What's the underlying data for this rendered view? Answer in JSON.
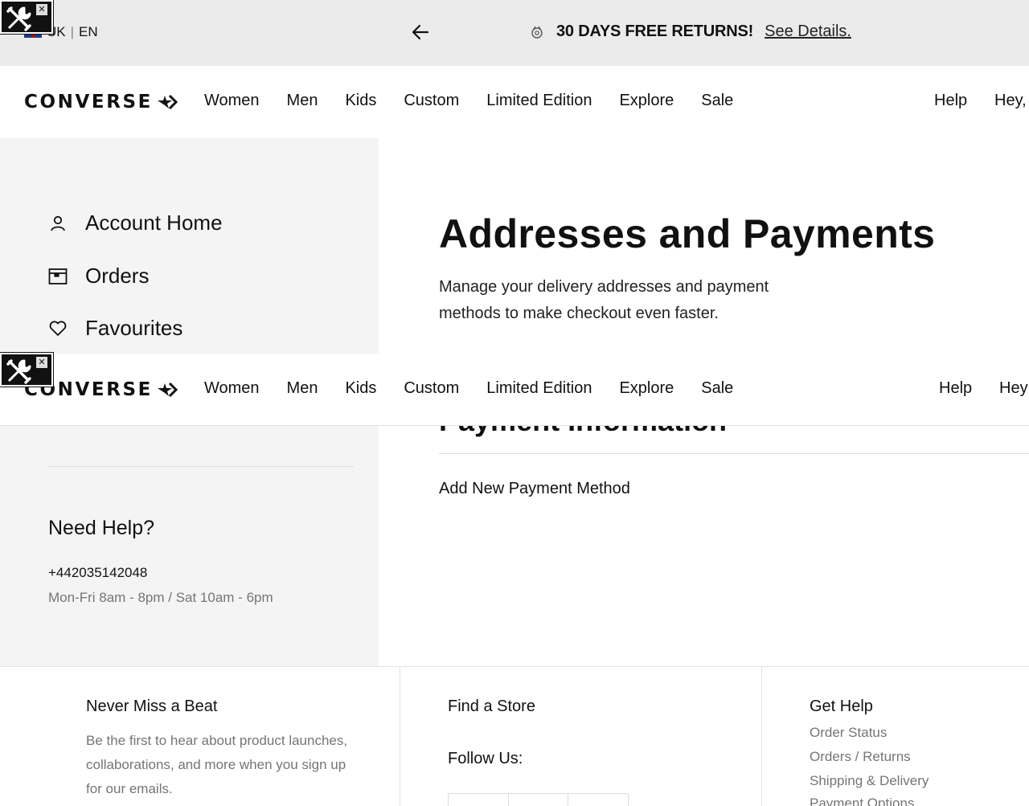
{
  "topbar": {
    "country": "UK",
    "language": "EN",
    "separator": "|",
    "promo_text": "30 DAYS FREE RETURNS!",
    "promo_link": "See Details."
  },
  "brand": {
    "logo_text": "CONVERSE"
  },
  "nav": [
    "Women",
    "Men",
    "Kids",
    "Custom",
    "Limited Edition",
    "Explore",
    "Sale"
  ],
  "header_right": {
    "help": "Help",
    "greeting": "Hey,",
    "greeting_cut": "Hey"
  },
  "sidebar": {
    "items": [
      {
        "label": "Account Home",
        "icon": "user-icon"
      },
      {
        "label": "Orders",
        "icon": "box-icon"
      },
      {
        "label": "Favourites",
        "icon": "heart-icon"
      }
    ],
    "help_title": "Need Help?",
    "help_phone": "+442035142048",
    "help_hours": "Mon-Fri 8am - 8pm / Sat 10am - 6pm"
  },
  "main": {
    "title": "Addresses and Payments",
    "description": "Manage your delivery addresses and payment methods to make checkout even faster.",
    "payment_title": "Payment Information",
    "add_payment": "Add New Payment Method"
  },
  "footer": {
    "col1_title": "Never Miss a Beat",
    "col1_text": "Be the first to hear about product launches, collaborations, and more when you sign up for our emails.",
    "col2_title": "Find a Store",
    "col2_follow": "Follow Us:",
    "col3_title": "Get Help",
    "col3_links": [
      "Order Status",
      "Orders / Returns",
      "Shipping & Delivery",
      "Payment Options"
    ]
  },
  "colors": {
    "topbar_bg": "#ebebeb",
    "sidebar_bg": "#f4f4f4",
    "muted_text": "#757575"
  }
}
